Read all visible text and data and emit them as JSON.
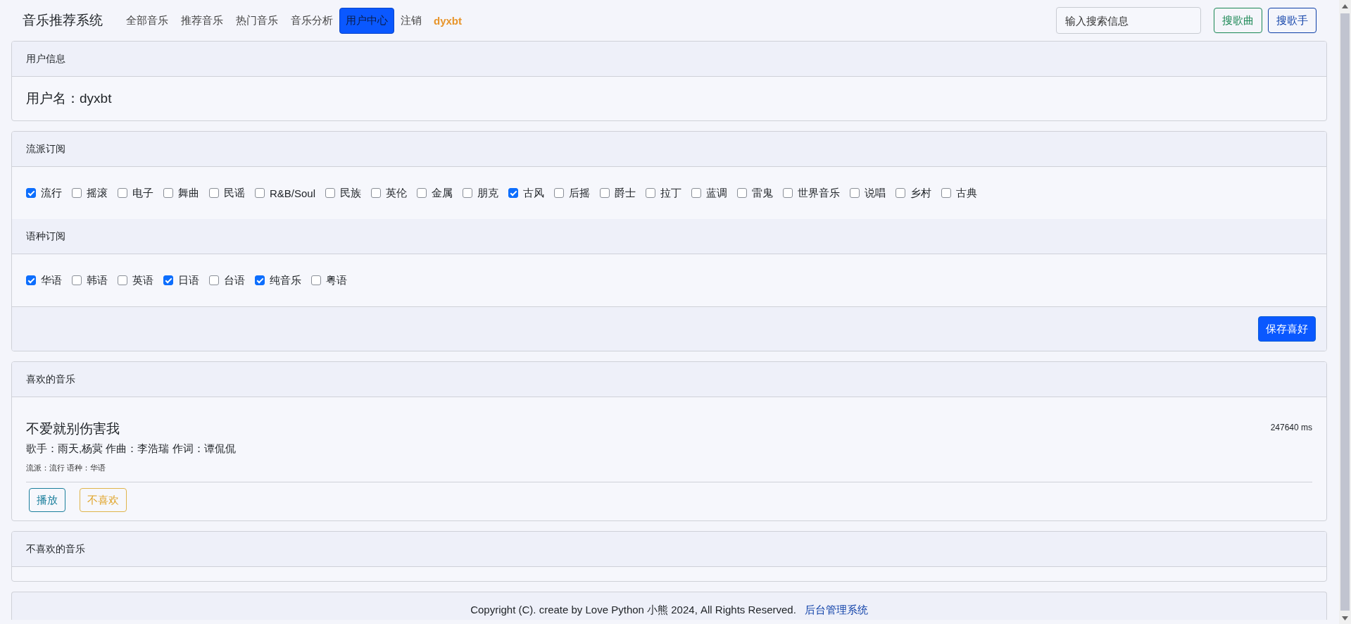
{
  "nav": {
    "brand": "音乐推荐系统",
    "links": [
      {
        "label": "全部音乐",
        "selected": false
      },
      {
        "label": "推荐音乐",
        "selected": false
      },
      {
        "label": "热门音乐",
        "selected": false
      },
      {
        "label": "音乐分析",
        "selected": false
      },
      {
        "label": "用户中心",
        "selected": true
      },
      {
        "label": "注销",
        "selected": false
      }
    ],
    "username": "dyxbt",
    "search": {
      "placeholder": "输入搜索信息"
    },
    "buttons": [
      {
        "label": "搜歌曲",
        "kind": "success"
      },
      {
        "label": "搜歌手",
        "kind": "primary"
      }
    ]
  },
  "user_info": {
    "title": "用户信息",
    "username": "用户名：dyxbt"
  },
  "preferences": {
    "genre_title": "流派订阅",
    "genres": [
      {
        "label": "流行",
        "checked": true
      },
      {
        "label": "摇滚",
        "checked": false
      },
      {
        "label": "电子",
        "checked": false
      },
      {
        "label": "舞曲",
        "checked": false
      },
      {
        "label": "民谣",
        "checked": false
      },
      {
        "label": "R&B/Soul",
        "checked": false
      },
      {
        "label": "民族",
        "checked": false
      },
      {
        "label": "英伦",
        "checked": false
      },
      {
        "label": "金属",
        "checked": false
      },
      {
        "label": "朋克",
        "checked": false
      },
      {
        "label": "古风",
        "checked": true
      },
      {
        "label": "后摇",
        "checked": false
      },
      {
        "label": "爵士",
        "checked": false
      },
      {
        "label": "拉丁",
        "checked": false
      },
      {
        "label": "蓝调",
        "checked": false
      },
      {
        "label": "雷鬼",
        "checked": false
      },
      {
        "label": "世界音乐",
        "checked": false
      },
      {
        "label": "说唱",
        "checked": false
      },
      {
        "label": "乡村",
        "checked": false
      },
      {
        "label": "古典",
        "checked": false
      }
    ],
    "language_title": "语种订阅",
    "languages": [
      {
        "label": "华语",
        "checked": true
      },
      {
        "label": "韩语",
        "checked": false
      },
      {
        "label": "英语",
        "checked": false
      },
      {
        "label": "日语",
        "checked": true
      },
      {
        "label": "台语",
        "checked": false
      },
      {
        "label": "纯音乐",
        "checked": true
      },
      {
        "label": "粤语",
        "checked": false
      }
    ],
    "save_button": "保存喜好"
  },
  "liked": {
    "title": "喜欢的音乐",
    "songs": [
      {
        "title": "不爱就别伤害我",
        "duration": "247640 ms",
        "credits": "歌手：雨天,杨蓂 作曲：李浩瑞 作词：谭侃侃",
        "tags": "流派：流行 语种：华语",
        "buttons": [
          {
            "label": "播放",
            "kind": "info"
          },
          {
            "label": "不喜欢",
            "kind": "warning"
          }
        ]
      }
    ]
  },
  "disliked": {
    "title": "不喜欢的音乐"
  },
  "footer": {
    "text": "Copyright (C). create by Love Python 小熊 2024, All Rights Reserved.",
    "link": "后台管理系统"
  }
}
